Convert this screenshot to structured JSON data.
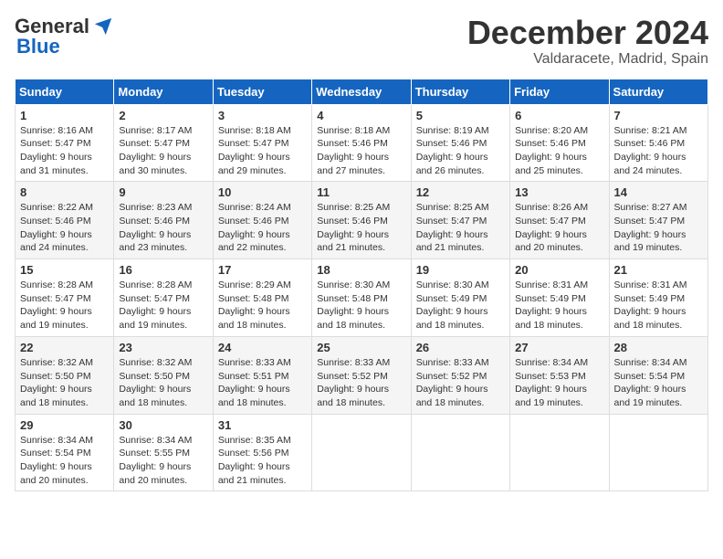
{
  "header": {
    "logo_general": "General",
    "logo_blue": "Blue",
    "month_title": "December 2024",
    "location": "Valdaracete, Madrid, Spain"
  },
  "days_of_week": [
    "Sunday",
    "Monday",
    "Tuesday",
    "Wednesday",
    "Thursday",
    "Friday",
    "Saturday"
  ],
  "weeks": [
    [
      {
        "day": "1",
        "sunrise": "Sunrise: 8:16 AM",
        "sunset": "Sunset: 5:47 PM",
        "daylight": "Daylight: 9 hours and 31 minutes."
      },
      {
        "day": "2",
        "sunrise": "Sunrise: 8:17 AM",
        "sunset": "Sunset: 5:47 PM",
        "daylight": "Daylight: 9 hours and 30 minutes."
      },
      {
        "day": "3",
        "sunrise": "Sunrise: 8:18 AM",
        "sunset": "Sunset: 5:47 PM",
        "daylight": "Daylight: 9 hours and 29 minutes."
      },
      {
        "day": "4",
        "sunrise": "Sunrise: 8:18 AM",
        "sunset": "Sunset: 5:46 PM",
        "daylight": "Daylight: 9 hours and 27 minutes."
      },
      {
        "day": "5",
        "sunrise": "Sunrise: 8:19 AM",
        "sunset": "Sunset: 5:46 PM",
        "daylight": "Daylight: 9 hours and 26 minutes."
      },
      {
        "day": "6",
        "sunrise": "Sunrise: 8:20 AM",
        "sunset": "Sunset: 5:46 PM",
        "daylight": "Daylight: 9 hours and 25 minutes."
      },
      {
        "day": "7",
        "sunrise": "Sunrise: 8:21 AM",
        "sunset": "Sunset: 5:46 PM",
        "daylight": "Daylight: 9 hours and 24 minutes."
      }
    ],
    [
      {
        "day": "8",
        "sunrise": "Sunrise: 8:22 AM",
        "sunset": "Sunset: 5:46 PM",
        "daylight": "Daylight: 9 hours and 24 minutes."
      },
      {
        "day": "9",
        "sunrise": "Sunrise: 8:23 AM",
        "sunset": "Sunset: 5:46 PM",
        "daylight": "Daylight: 9 hours and 23 minutes."
      },
      {
        "day": "10",
        "sunrise": "Sunrise: 8:24 AM",
        "sunset": "Sunset: 5:46 PM",
        "daylight": "Daylight: 9 hours and 22 minutes."
      },
      {
        "day": "11",
        "sunrise": "Sunrise: 8:25 AM",
        "sunset": "Sunset: 5:46 PM",
        "daylight": "Daylight: 9 hours and 21 minutes."
      },
      {
        "day": "12",
        "sunrise": "Sunrise: 8:25 AM",
        "sunset": "Sunset: 5:47 PM",
        "daylight": "Daylight: 9 hours and 21 minutes."
      },
      {
        "day": "13",
        "sunrise": "Sunrise: 8:26 AM",
        "sunset": "Sunset: 5:47 PM",
        "daylight": "Daylight: 9 hours and 20 minutes."
      },
      {
        "day": "14",
        "sunrise": "Sunrise: 8:27 AM",
        "sunset": "Sunset: 5:47 PM",
        "daylight": "Daylight: 9 hours and 19 minutes."
      }
    ],
    [
      {
        "day": "15",
        "sunrise": "Sunrise: 8:28 AM",
        "sunset": "Sunset: 5:47 PM",
        "daylight": "Daylight: 9 hours and 19 minutes."
      },
      {
        "day": "16",
        "sunrise": "Sunrise: 8:28 AM",
        "sunset": "Sunset: 5:47 PM",
        "daylight": "Daylight: 9 hours and 19 minutes."
      },
      {
        "day": "17",
        "sunrise": "Sunrise: 8:29 AM",
        "sunset": "Sunset: 5:48 PM",
        "daylight": "Daylight: 9 hours and 18 minutes."
      },
      {
        "day": "18",
        "sunrise": "Sunrise: 8:30 AM",
        "sunset": "Sunset: 5:48 PM",
        "daylight": "Daylight: 9 hours and 18 minutes."
      },
      {
        "day": "19",
        "sunrise": "Sunrise: 8:30 AM",
        "sunset": "Sunset: 5:49 PM",
        "daylight": "Daylight: 9 hours and 18 minutes."
      },
      {
        "day": "20",
        "sunrise": "Sunrise: 8:31 AM",
        "sunset": "Sunset: 5:49 PM",
        "daylight": "Daylight: 9 hours and 18 minutes."
      },
      {
        "day": "21",
        "sunrise": "Sunrise: 8:31 AM",
        "sunset": "Sunset: 5:49 PM",
        "daylight": "Daylight: 9 hours and 18 minutes."
      }
    ],
    [
      {
        "day": "22",
        "sunrise": "Sunrise: 8:32 AM",
        "sunset": "Sunset: 5:50 PM",
        "daylight": "Daylight: 9 hours and 18 minutes."
      },
      {
        "day": "23",
        "sunrise": "Sunrise: 8:32 AM",
        "sunset": "Sunset: 5:50 PM",
        "daylight": "Daylight: 9 hours and 18 minutes."
      },
      {
        "day": "24",
        "sunrise": "Sunrise: 8:33 AM",
        "sunset": "Sunset: 5:51 PM",
        "daylight": "Daylight: 9 hours and 18 minutes."
      },
      {
        "day": "25",
        "sunrise": "Sunrise: 8:33 AM",
        "sunset": "Sunset: 5:52 PM",
        "daylight": "Daylight: 9 hours and 18 minutes."
      },
      {
        "day": "26",
        "sunrise": "Sunrise: 8:33 AM",
        "sunset": "Sunset: 5:52 PM",
        "daylight": "Daylight: 9 hours and 18 minutes."
      },
      {
        "day": "27",
        "sunrise": "Sunrise: 8:34 AM",
        "sunset": "Sunset: 5:53 PM",
        "daylight": "Daylight: 9 hours and 19 minutes."
      },
      {
        "day": "28",
        "sunrise": "Sunrise: 8:34 AM",
        "sunset": "Sunset: 5:54 PM",
        "daylight": "Daylight: 9 hours and 19 minutes."
      }
    ],
    [
      {
        "day": "29",
        "sunrise": "Sunrise: 8:34 AM",
        "sunset": "Sunset: 5:54 PM",
        "daylight": "Daylight: 9 hours and 20 minutes."
      },
      {
        "day": "30",
        "sunrise": "Sunrise: 8:34 AM",
        "sunset": "Sunset: 5:55 PM",
        "daylight": "Daylight: 9 hours and 20 minutes."
      },
      {
        "day": "31",
        "sunrise": "Sunrise: 8:35 AM",
        "sunset": "Sunset: 5:56 PM",
        "daylight": "Daylight: 9 hours and 21 minutes."
      },
      null,
      null,
      null,
      null
    ]
  ]
}
